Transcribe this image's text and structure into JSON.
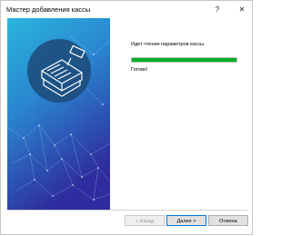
{
  "window": {
    "title": "Мастер добавления кассы",
    "help_symbol": "?",
    "close_symbol": "✕"
  },
  "content": {
    "status_text": "Идет чтение параметров кассы",
    "progress_percent": 100,
    "done_text": "Готово!"
  },
  "buttons": {
    "back": "< Назад",
    "next": "Далее >",
    "cancel": "Отмена"
  },
  "colors": {
    "progress": "#06b025",
    "sidebar_top": "#2aa7d6",
    "sidebar_bottom": "#2d2fa6"
  },
  "icons": {
    "help": "help-icon",
    "close": "close-icon",
    "register": "cash-register-icon"
  }
}
